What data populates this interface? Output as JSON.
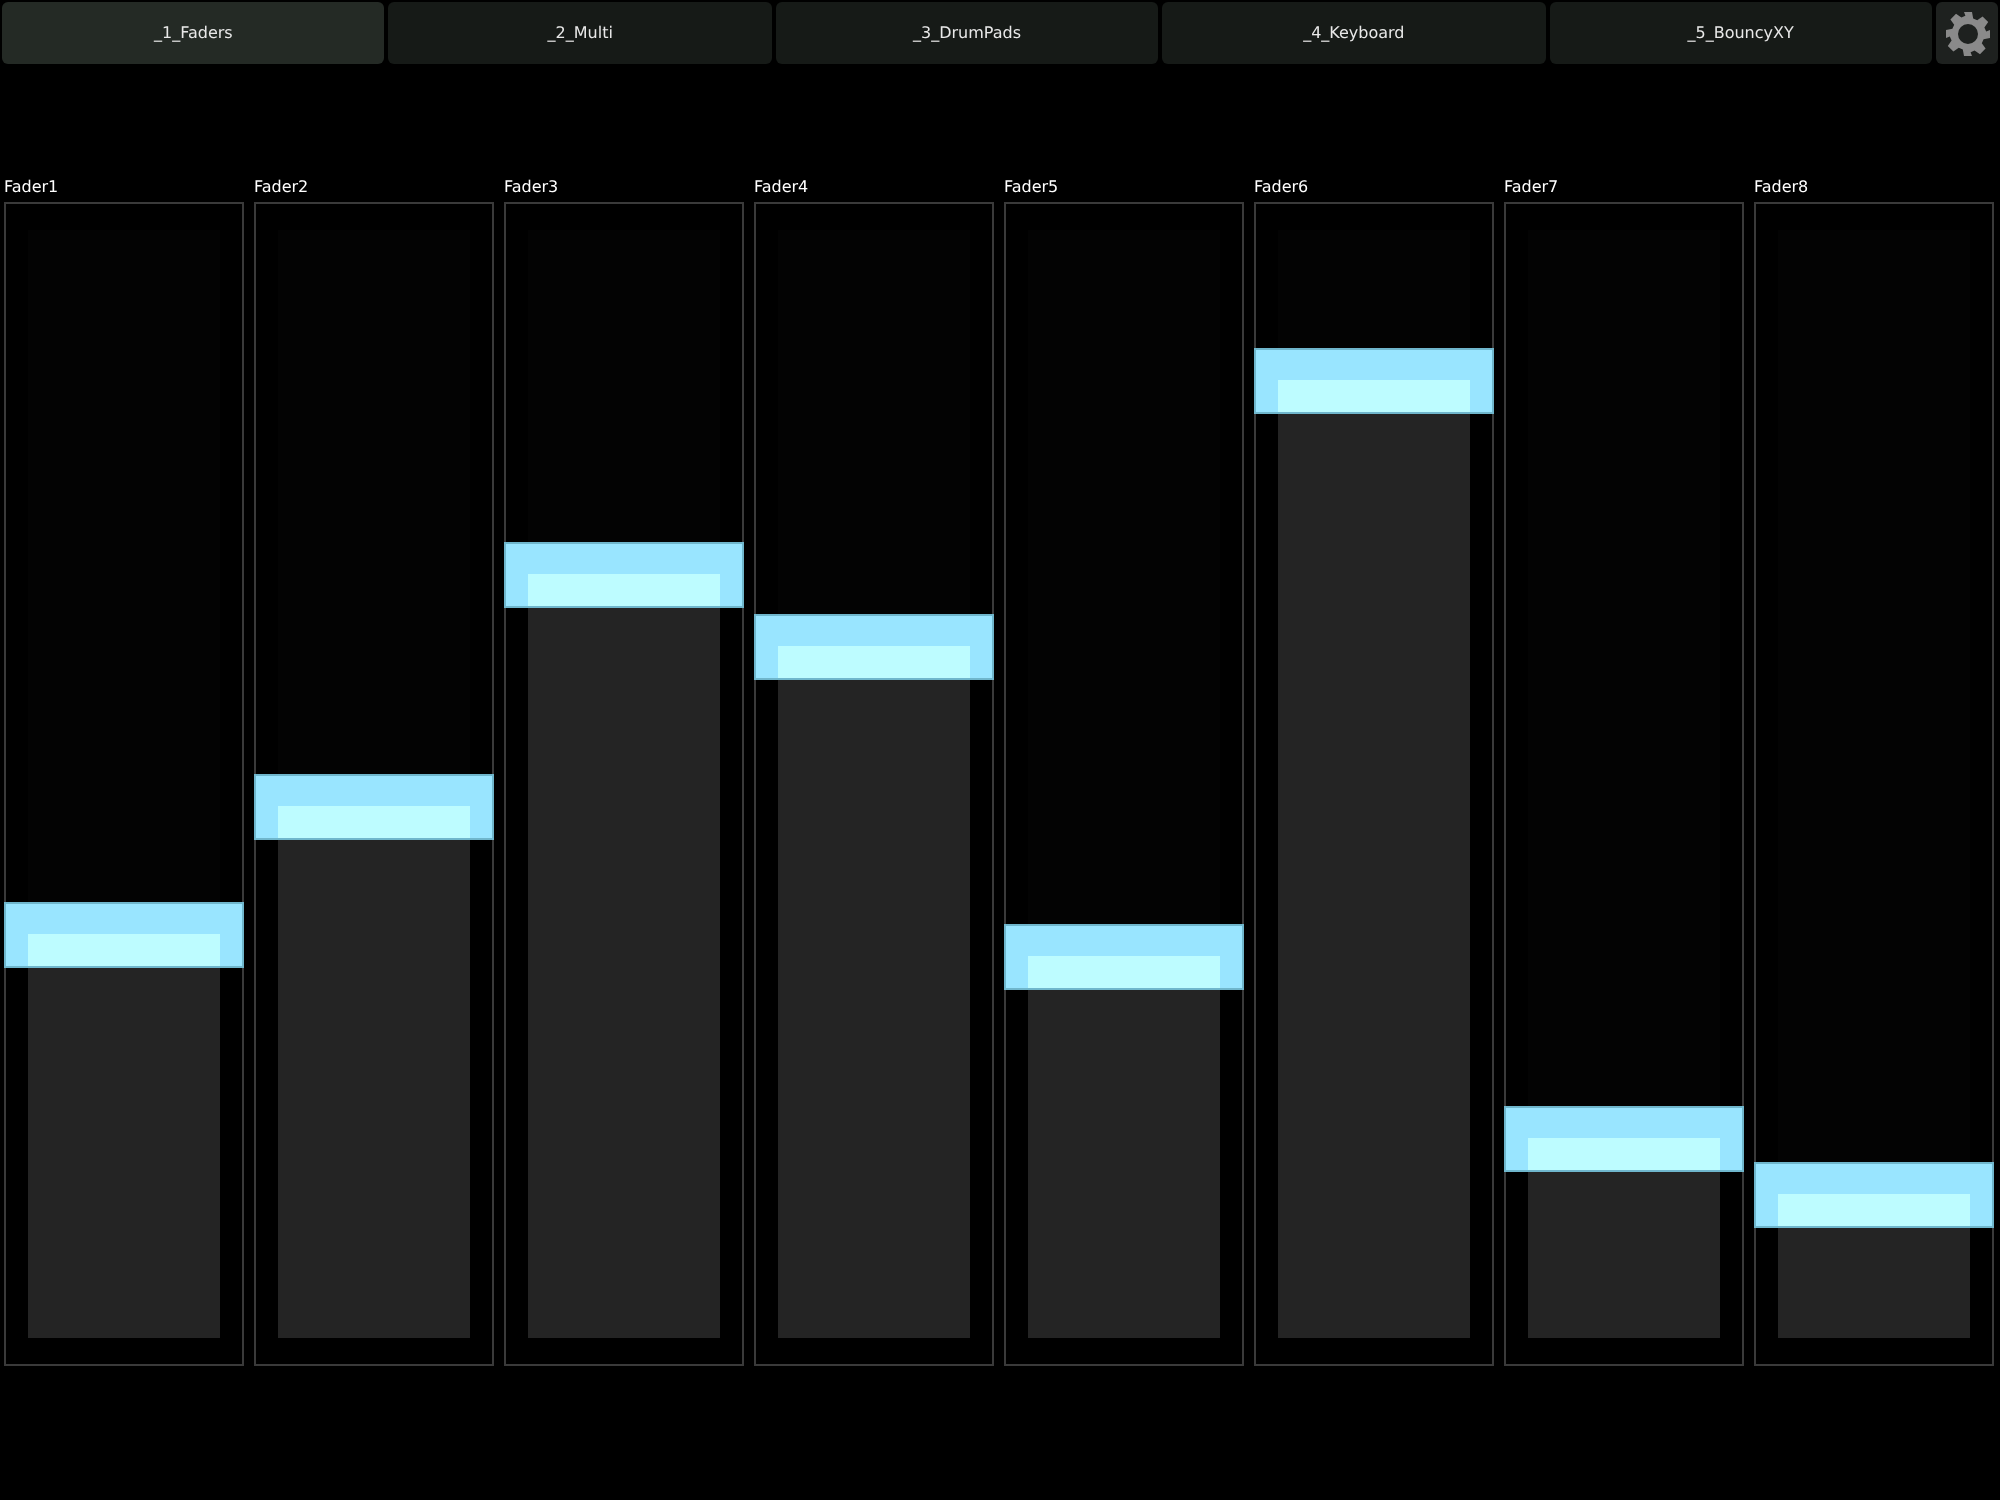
{
  "tabs": [
    {
      "label": "_1_Faders",
      "selected": true
    },
    {
      "label": "_2_Multi",
      "selected": false
    },
    {
      "label": "_3_DrumPads",
      "selected": false
    },
    {
      "label": "_4_Keyboard",
      "selected": false
    },
    {
      "label": "_5_BouncyXY",
      "selected": false
    }
  ],
  "faders": [
    {
      "label": "Fader1",
      "level": 0.365
    },
    {
      "label": "Fader2",
      "level": 0.48
    },
    {
      "label": "Fader3",
      "level": 0.69
    },
    {
      "label": "Fader4",
      "level": 0.625
    },
    {
      "label": "Fader5",
      "level": 0.345
    },
    {
      "label": "Fader6",
      "level": 0.865
    },
    {
      "label": "Fader7",
      "level": 0.18
    },
    {
      "label": "Fader8",
      "level": 0.13
    }
  ]
}
